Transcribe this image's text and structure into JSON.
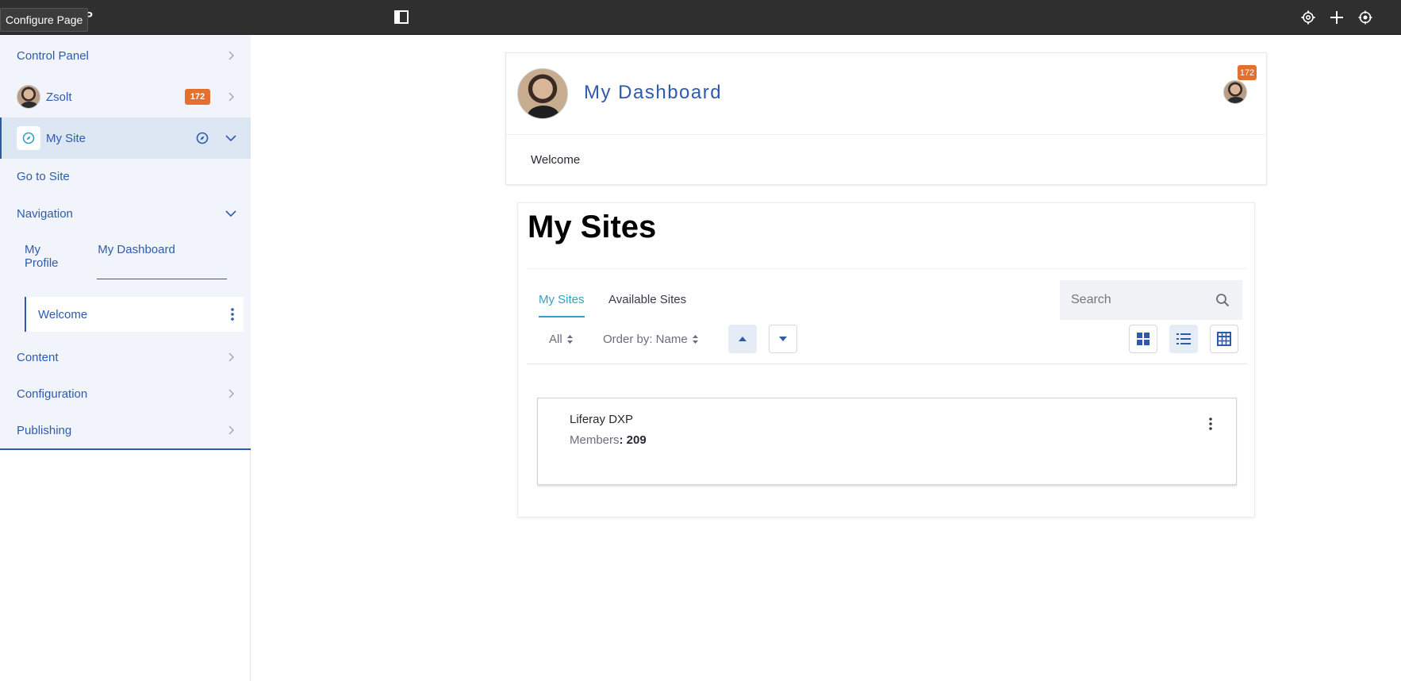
{
  "topbar": {
    "brand": "DXP",
    "tooltip": "Configure Page",
    "icons": [
      "panel-toggle-icon",
      "gear-icon",
      "plus-icon",
      "simulation-icon"
    ]
  },
  "sidebar": {
    "control_panel": "Control Panel",
    "user_name": "Zsolt",
    "notification_count": "172",
    "site_name": "My Site",
    "go_to_site": "Go to Site",
    "navigation": "Navigation",
    "nav_tabs": [
      "My Profile",
      "My Dashboard"
    ],
    "active_page": "Welcome",
    "sections": [
      "Content",
      "Configuration",
      "Publishing"
    ]
  },
  "dashboard": {
    "title": "My Dashboard",
    "badge": "172",
    "nav_item": "Welcome"
  },
  "my_sites": {
    "title": "My Sites",
    "tabs": [
      "My Sites",
      "Available Sites"
    ],
    "search_placeholder": "Search",
    "filter": "All",
    "order_by": "Order by: Name",
    "sites": [
      {
        "name": "Liferay DXP",
        "members_label": "Members",
        "members_count": ": 209"
      }
    ]
  },
  "colors": {
    "accent": "#2e5aac",
    "badge": "#e4702f",
    "tab_active": "#2fa4c1",
    "topbar": "#302f30"
  }
}
